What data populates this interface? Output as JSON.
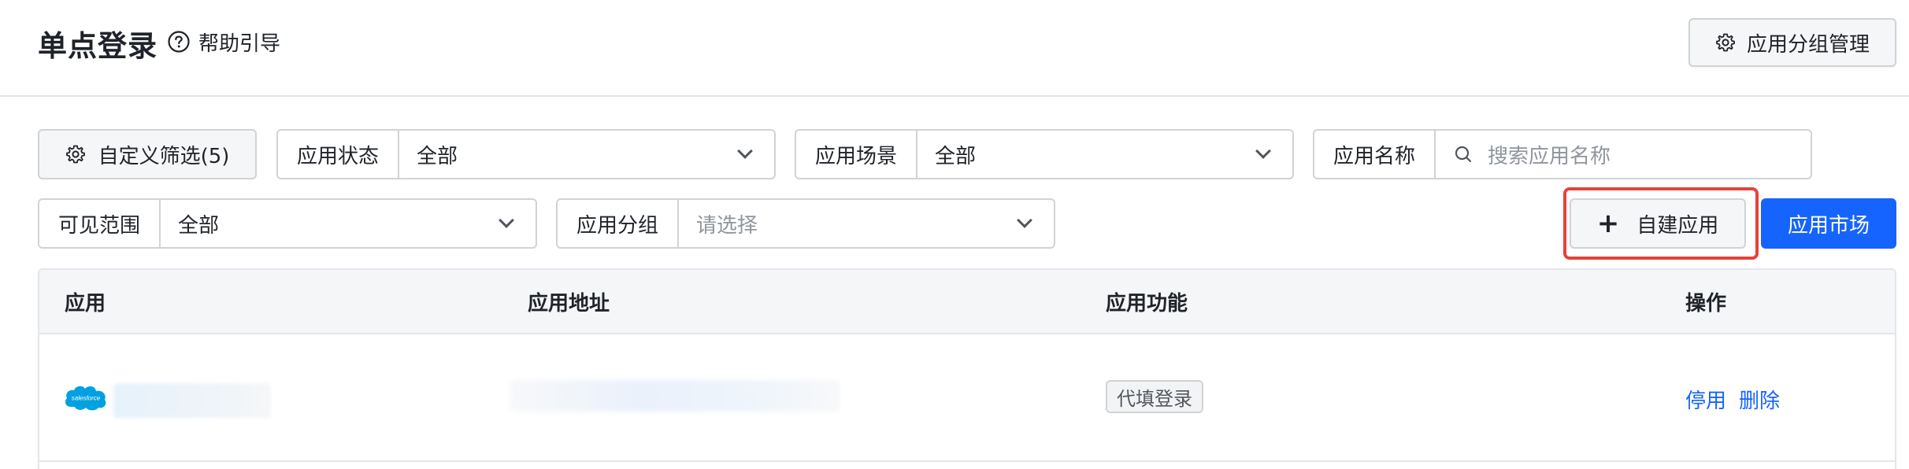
{
  "header": {
    "title": "单点登录",
    "help_label": "帮助引导",
    "group_manage_label": "应用分组管理"
  },
  "filters": {
    "custom_filter_label": "自定义筛选(5)",
    "status": {
      "label": "应用状态",
      "value": "全部"
    },
    "scene": {
      "label": "应用场景",
      "value": "全部"
    },
    "name": {
      "label": "应用名称",
      "placeholder": "搜索应用名称"
    },
    "scope": {
      "label": "可见范围",
      "value": "全部"
    },
    "group": {
      "label": "应用分组",
      "placeholder": "请选择"
    }
  },
  "actions": {
    "create_label": "自建应用",
    "market_label": "应用市场"
  },
  "table": {
    "columns": [
      "应用",
      "应用地址",
      "应用功能",
      "操作"
    ],
    "rows": [
      {
        "logo_text": "salesforce",
        "feature_tag": "代填登录",
        "ops": [
          "停用",
          "删除"
        ]
      }
    ]
  },
  "colors": {
    "primary": "#1664ff",
    "highlight_border": "#e8413c",
    "salesforce": "#00a1e0"
  }
}
